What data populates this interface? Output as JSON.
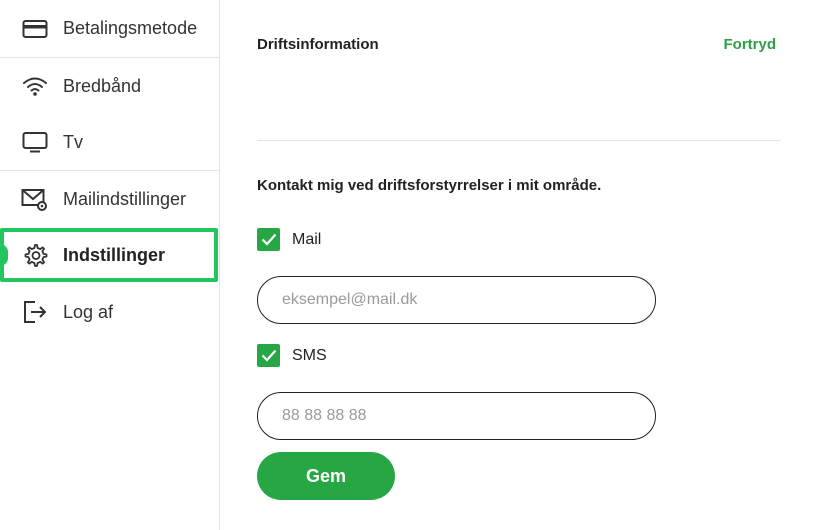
{
  "sidebar": {
    "items": [
      {
        "label": "Betalingsmetode",
        "icon": "credit-card-icon"
      },
      {
        "label": "Bredbånd",
        "icon": "wifi-icon"
      },
      {
        "label": "Tv",
        "icon": "tv-icon"
      },
      {
        "label": "Mailindstillinger",
        "icon": "mail-settings-icon"
      },
      {
        "label": "Indstillinger",
        "icon": "gear-icon",
        "active": true
      },
      {
        "label": "Log af",
        "icon": "logout-icon"
      }
    ]
  },
  "main": {
    "section_title": "Driftsinformation",
    "cancel_label": "Fortryd",
    "contact_text": "Kontakt mig ved driftsforstyrrelser i mit område.",
    "mail": {
      "label": "Mail",
      "checked": true,
      "placeholder": "eksempel@mail.dk",
      "value": ""
    },
    "sms": {
      "label": "SMS",
      "checked": true,
      "placeholder": "88 88 88 88",
      "value": ""
    },
    "save_label": "Gem"
  },
  "colors": {
    "accent": "#26a744",
    "active_border": "#22c55e",
    "link": "#2ea043"
  }
}
